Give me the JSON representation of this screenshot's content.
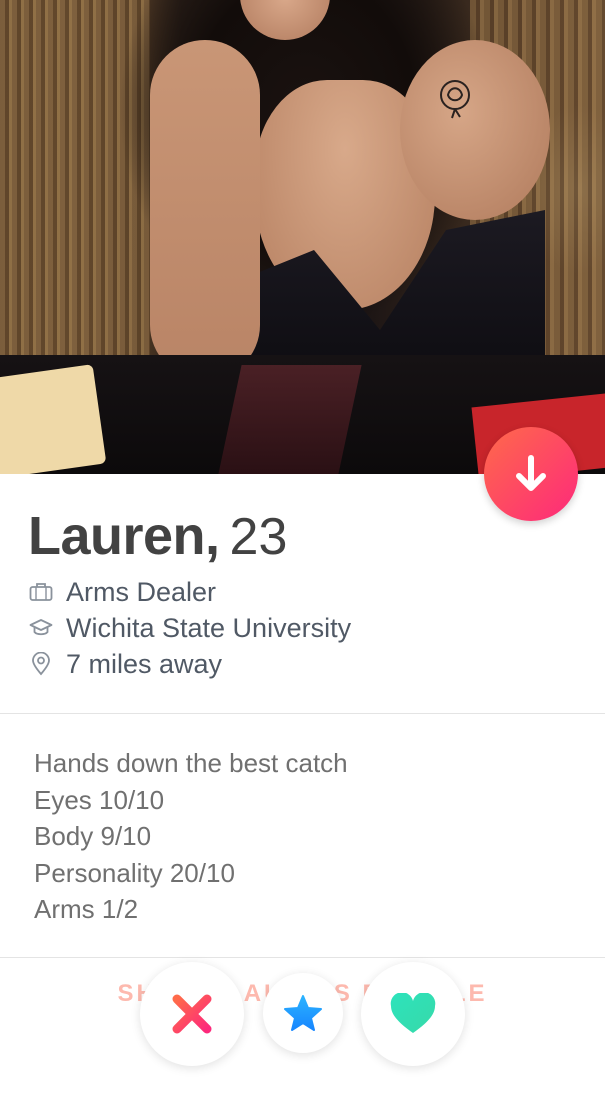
{
  "profile": {
    "name": "Lauren,",
    "age": "23",
    "job": "Arms Dealer",
    "school": "Wichita State University",
    "distance": "7 miles away"
  },
  "bio": {
    "lines": [
      "Hands down the best catch",
      "Eyes 10/10",
      "Body 9/10",
      "Personality 20/10",
      "Arms 1/2"
    ]
  },
  "footer": {
    "faded_text": "SHARE LAURA'S PROFILE"
  },
  "icons": {
    "job": "briefcase-icon",
    "school": "graduation-cap-icon",
    "distance": "location-pin-icon",
    "collapse": "arrow-down-icon",
    "nope": "x-icon",
    "superlike": "star-icon",
    "like": "heart-icon"
  },
  "colors": {
    "accent_gradient_start": "#ff6a4a",
    "accent_gradient_end": "#fd297b",
    "superlike_blue": "#1786ff",
    "like_green": "#2de3bc",
    "text_dark": "#424242",
    "text_muted": "#707070"
  }
}
